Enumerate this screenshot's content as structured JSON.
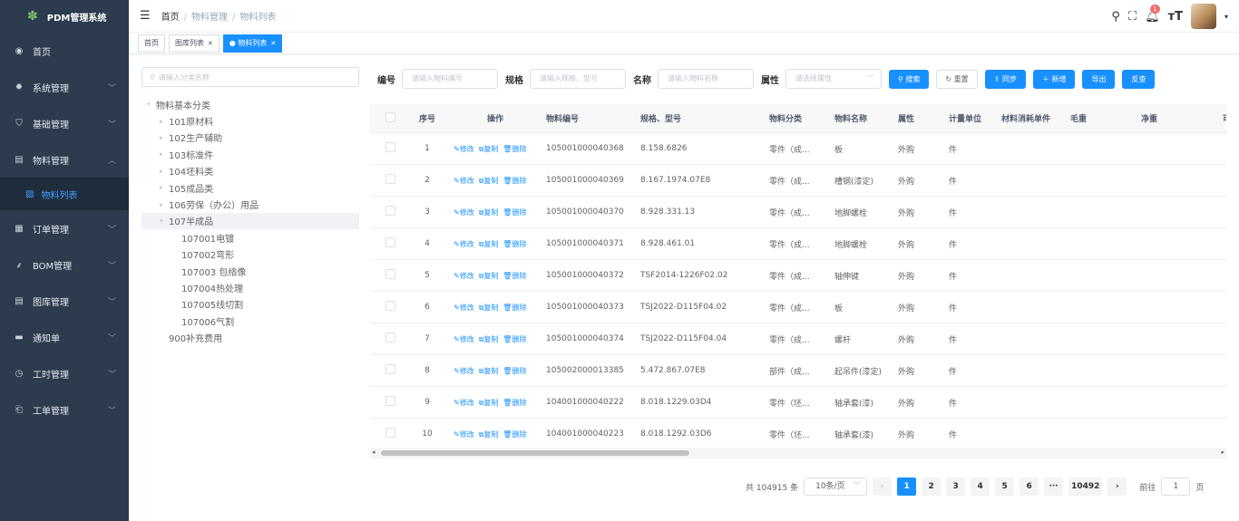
{
  "sidebar": {
    "title": "PDM管理系统",
    "items": [
      {
        "label": "首页",
        "icon": "dashboard-icon"
      },
      {
        "label": "系统管理",
        "icon": "gear-icon"
      },
      {
        "label": "基础管理",
        "icon": "shield-icon"
      },
      {
        "label": "物料管理",
        "icon": "document-icon"
      },
      {
        "label": "订单管理",
        "icon": "grid-icon"
      },
      {
        "label": "BOM管理",
        "icon": "tree-icon"
      },
      {
        "label": "图库管理",
        "icon": "document-icon"
      },
      {
        "label": "通知单",
        "icon": "message-icon"
      },
      {
        "label": "工时管理",
        "icon": "clock-icon"
      },
      {
        "label": "工单管理",
        "icon": "ticket-icon"
      }
    ],
    "sub_item": "物料列表"
  },
  "breadcrumb": {
    "home": "首页",
    "level1": "物料管理",
    "level2": "物料列表",
    "sep": "/"
  },
  "header": {
    "notification_count": "1"
  },
  "tabs": {
    "home": "首页",
    "gallery": "图库列表",
    "materials": "物料列表"
  },
  "tree": {
    "search_placeholder": "请输入分类名称",
    "nodes": [
      {
        "label": "物料基本分类",
        "level": 0,
        "caret": "▾"
      },
      {
        "label": "101原材料",
        "level": 1,
        "caret": "▸"
      },
      {
        "label": "102生产辅助",
        "level": 1,
        "caret": "▸"
      },
      {
        "label": "103标准件",
        "level": 1,
        "caret": "▸"
      },
      {
        "label": "104坯料类",
        "level": 1,
        "caret": "▸"
      },
      {
        "label": "105成品类",
        "level": 1,
        "caret": "▸"
      },
      {
        "label": "106劳保（办公）用品",
        "level": 1,
        "caret": "▸"
      },
      {
        "label": "107半成品",
        "level": 1,
        "caret": "▾"
      },
      {
        "label": "107001电镀",
        "level": 2,
        "caret": ""
      },
      {
        "label": "107002弯形",
        "level": 2,
        "caret": ""
      },
      {
        "label": "107003 包络像",
        "level": 2,
        "caret": ""
      },
      {
        "label": "107004热处理",
        "level": 2,
        "caret": ""
      },
      {
        "label": "107005线切割",
        "level": 2,
        "caret": ""
      },
      {
        "label": "107006气割",
        "level": 2,
        "caret": ""
      },
      {
        "label": "900补充费用",
        "level": 1,
        "caret": ""
      }
    ]
  },
  "filters": {
    "code_label": "编号",
    "code_placeholder": "请输入物料编号",
    "spec_label": "规格",
    "spec_placeholder": "请输入规格、型号",
    "name_label": "名称",
    "name_placeholder": "请输入物料名称",
    "attr_label": "属性",
    "attr_placeholder": "请选择属性",
    "buttons": {
      "search": "搜索",
      "reset": "重置",
      "sync": "同步",
      "add": "新增",
      "export": "导出",
      "check": "反查"
    }
  },
  "table": {
    "columns": [
      "序号",
      "操作",
      "物料编号",
      "规格、型号",
      "物料分类",
      "物料名称",
      "属性",
      "计量单位",
      "材料消耗单件",
      "毛重",
      "净重",
      "可"
    ],
    "actions": {
      "edit": "修改",
      "copy": "复制",
      "delete": "删除"
    },
    "rows": [
      {
        "no": "1",
        "code": "105001000040368",
        "spec": "8.158.6826",
        "cat": "零件（成...",
        "name": "板",
        "attr": "外购",
        "unit": "件"
      },
      {
        "no": "2",
        "code": "105001000040369",
        "spec": "8.167.1974.07E8",
        "cat": "零件（成...",
        "name": "槽钢(漆定)",
        "attr": "外购",
        "unit": "件"
      },
      {
        "no": "3",
        "code": "105001000040370",
        "spec": "8.928.331.13",
        "cat": "零件（成...",
        "name": "地脚螺栓",
        "attr": "外购",
        "unit": "件"
      },
      {
        "no": "4",
        "code": "105001000040371",
        "spec": "8.928.461.01",
        "cat": "零件（成...",
        "name": "地脚螺栓",
        "attr": "外购",
        "unit": "件"
      },
      {
        "no": "5",
        "code": "105001000040372",
        "spec": "TSF2014-1226F02.02",
        "cat": "零件（成...",
        "name": "轴伸键",
        "attr": "外购",
        "unit": "件"
      },
      {
        "no": "6",
        "code": "105001000040373",
        "spec": "TSJ2022-D115F04.02",
        "cat": "零件（成...",
        "name": "板",
        "attr": "外购",
        "unit": "件"
      },
      {
        "no": "7",
        "code": "105001000040374",
        "spec": "TSJ2022-D115F04.04",
        "cat": "零件（成...",
        "name": "螺杆",
        "attr": "外购",
        "unit": "件"
      },
      {
        "no": "8",
        "code": "105002000013385",
        "spec": "5.472.867.07E8",
        "cat": "部件（成...",
        "name": "起吊件(漆定)",
        "attr": "外购",
        "unit": "件"
      },
      {
        "no": "9",
        "code": "104001000040222",
        "spec": "8.018.1229.03D4",
        "cat": "零件（坯...",
        "name": "轴承套(漆)",
        "attr": "外购",
        "unit": "件"
      },
      {
        "no": "10",
        "code": "104001000040223",
        "spec": "8.018.1292.03D6",
        "cat": "零件（坯...",
        "name": "轴承套(漆)",
        "attr": "外购",
        "unit": "件"
      }
    ]
  },
  "pagination": {
    "total": "共 104915 条",
    "page_size": "10条/页",
    "pages": [
      "1",
      "2",
      "3",
      "4",
      "5",
      "6",
      "···",
      "10492"
    ],
    "goto_label": "前往",
    "goto_value": "1",
    "page_suffix": "页"
  }
}
